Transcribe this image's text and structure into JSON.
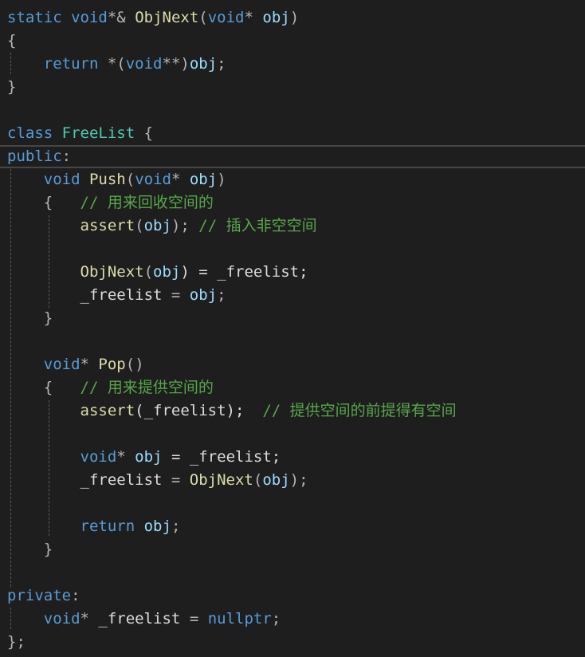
{
  "colors": {
    "background": "#1e1e1e",
    "keyword": "#569cd6",
    "function": "#dcdcaa",
    "type": "#4ec9b0",
    "parameter": "#9cdcfe",
    "punctuation": "#b4b4b4",
    "text": "#dcdcdc",
    "comment": "#57a64a",
    "indent_guide": "#5a5a5a",
    "current_line_border": "#464646"
  },
  "code": {
    "objnext_sig": {
      "kw_static": "static",
      "kw_void": "void",
      "ops1": "*& ",
      "fn_name": "ObjNext",
      "paren_open": "(",
      "kw_void2": "void",
      "ops2": "* ",
      "param": "obj",
      "paren_close": ")"
    },
    "brace_open_1": "{",
    "return_line": {
      "kw_return": "return",
      "ops": " *(",
      "kw_void": "void",
      "ops2": "**)",
      "param": "obj",
      "semi": ";"
    },
    "brace_close_1": "}",
    "class_line": {
      "kw_class": "class",
      "type_name": "FreeList",
      "brace": " {"
    },
    "public_line": {
      "kw_public": "public",
      "colon": ":"
    },
    "push_sig": {
      "kw_void": "void",
      "fn_name": "Push",
      "paren_open": "(",
      "kw_void2": "void",
      "ops": "* ",
      "param": "obj",
      "paren_close": ")"
    },
    "push_open": {
      "brace": "{",
      "comment": "// 用来回收空间的"
    },
    "push_assert": {
      "fn_name": "assert",
      "paren_open": "(",
      "param": "obj",
      "paren_close": ");",
      "comment": "// 插入非空空间"
    },
    "push_objnext": {
      "fn_name": "ObjNext",
      "paren_open": "(",
      "param": "obj",
      "mid": ") = _freelist;"
    },
    "push_assign": {
      "member": "_freelist",
      "eq": " = ",
      "param": "obj",
      "semi": ";"
    },
    "push_close": "}",
    "pop_sig": {
      "kw_void": "void",
      "ops": "* ",
      "fn_name": "Pop",
      "parens": "()"
    },
    "pop_open": {
      "brace": "{",
      "comment": "// 用来提供空间的"
    },
    "pop_assert": {
      "fn_name": "assert",
      "rest": "(_freelist);",
      "comment": "// 提供空间的前提得有空间"
    },
    "pop_decl": {
      "kw_void": "void",
      "ops": "* ",
      "var": "obj",
      "rest": " = _freelist;"
    },
    "pop_assign": {
      "member": "_freelist",
      "eq": " = ",
      "fn_name": "ObjNext",
      "paren_open": "(",
      "var": "obj",
      "paren_close": ");"
    },
    "pop_return": {
      "kw_return": "return",
      "var": "obj",
      "semi": ";"
    },
    "pop_close": "}",
    "private_line": {
      "kw_private": "private",
      "colon": ":"
    },
    "member_decl": {
      "kw_void": "void",
      "ops": "* ",
      "member": "_freelist",
      "eq": " = ",
      "kw_nullptr": "nullptr",
      "semi": ";"
    },
    "class_close": "};"
  }
}
